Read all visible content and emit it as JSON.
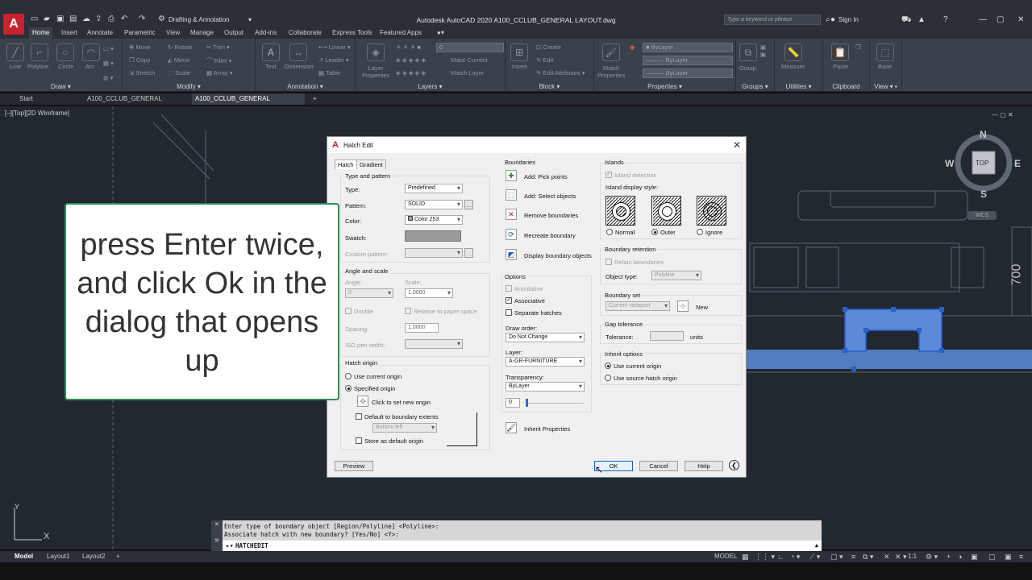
{
  "app": {
    "logo": "A",
    "workspace": "Drafting & Annotation",
    "window_title": "Autodesk AutoCAD 2020   A100_CCLUB_GENERAL LAYOUT.dwg",
    "search_placeholder": "Type a keyword or phrase",
    "sign_in": "Sign In"
  },
  "ribbon_tabs": [
    "Home",
    "Insert",
    "Annotate",
    "Parametric",
    "View",
    "Manage",
    "Output",
    "Add-ins",
    "Collaborate",
    "Express Tools",
    "Featured Apps"
  ],
  "ribbon": {
    "draw": {
      "title": "Draw",
      "tools": [
        "Line",
        "Polyline",
        "Circle",
        "Arc"
      ]
    },
    "modify": {
      "title": "Modify",
      "tools": [
        "Move",
        "Rotate",
        "Trim",
        "Copy",
        "Mirror",
        "Fillet",
        "Stretch",
        "Scale",
        "Array"
      ]
    },
    "annotation": {
      "title": "Annotation",
      "tools": [
        "Text",
        "Dimension",
        "Linear",
        "Leader",
        "Table"
      ]
    },
    "layers": {
      "title": "Layers",
      "tools": [
        "Layer Properties",
        "Make Current",
        "Match Layer"
      ],
      "current": "0"
    },
    "block": {
      "title": "Block",
      "tools": [
        "Insert",
        "Create",
        "Edit",
        "Edit Attributes"
      ]
    },
    "properties": {
      "title": "Properties",
      "tools": [
        "Match Properties"
      ],
      "bylayer": "ByLayer"
    },
    "groups": {
      "title": "Groups",
      "tools": [
        "Group"
      ]
    },
    "utilities": {
      "title": "Utilities",
      "tools": [
        "Measure"
      ]
    },
    "clipboard": {
      "title": "Clipboard",
      "tools": [
        "Paste"
      ]
    },
    "view": {
      "title": "View",
      "tools": [
        "Base"
      ]
    }
  },
  "doc_tabs": [
    "Start",
    "A100_CCLUB_GENERAL Import",
    "A100_CCLUB_GENERAL LAYOUT*"
  ],
  "viewport_label": "[–][Top][2D Wireframe]",
  "viewcube": {
    "top": "TOP",
    "n": "N",
    "s": "S",
    "e": "E",
    "w": "W",
    "wcs": "WCS"
  },
  "dim_text": "700",
  "callout_text": "press Enter twice, and click Ok in the dialog that opens up",
  "dialog": {
    "title": "Hatch Edit",
    "tabs": [
      "Hatch",
      "Gradient"
    ],
    "type_pattern": {
      "title": "Type and pattern",
      "type_label": "Type:",
      "type_value": "Predefined",
      "pattern_label": "Pattern:",
      "pattern_value": "SOLID",
      "color_label": "Color:",
      "color_value": "Color 253",
      "swatch_label": "Swatch:",
      "custom_label": "Custom pattern:"
    },
    "angle_scale": {
      "title": "Angle and scale",
      "angle_label": "Angle:",
      "angle_value": "0",
      "scale_label": "Scale:",
      "scale_value": "1.0000",
      "double_label": "Double",
      "relative_label": "Relative to paper space",
      "spacing_label": "Spacing:",
      "spacing_value": "1.0000",
      "iso_label": "ISO pen width:"
    },
    "hatch_origin": {
      "title": "Hatch origin",
      "use_current": "Use current origin",
      "specified": "Specified origin",
      "click_set": "Click to set new origin",
      "default_extents": "Default to boundary extents",
      "bottom_left": "Bottom left",
      "store_default": "Store as default origin"
    },
    "boundaries": {
      "title": "Boundaries",
      "pick_points": "Add: Pick points",
      "select_objects": "Add: Select objects",
      "remove": "Remove boundaries",
      "recreate": "Recreate boundary",
      "display": "Display boundary objects"
    },
    "options": {
      "title": "Options",
      "annotative": "Annotative",
      "associative": "Associative",
      "separate": "Separate hatches",
      "draw_order_label": "Draw order:",
      "draw_order_value": "Do Not Change",
      "layer_label": "Layer:",
      "layer_value": "A-GR-FURNITURE",
      "transparency_label": "Transparency:",
      "transparency_value": "ByLayer",
      "transparency_number": "0"
    },
    "inherit_properties": "Inherit Properties",
    "islands": {
      "title": "Islands",
      "detection": "Island detection",
      "display_style": "Island display style:",
      "normal": "Normal",
      "outer": "Outer",
      "ignore": "Ignore"
    },
    "boundary_retention": {
      "title": "Boundary retention",
      "retain": "Retain boundaries",
      "object_type_label": "Object type:",
      "object_type_value": "Polyline"
    },
    "boundary_set": {
      "title": "Boundary set",
      "value": "Current viewport",
      "new": "New"
    },
    "gap_tolerance": {
      "title": "Gap tolerance",
      "tolerance_label": "Tolerance:",
      "units": "units"
    },
    "inherit_options": {
      "title": "Inherit options",
      "use_current": "Use current origin",
      "use_source": "Use source hatch origin"
    },
    "buttons": {
      "preview": "Preview",
      "ok": "OK",
      "cancel": "Cancel",
      "help": "Help"
    }
  },
  "command": {
    "line1": "Enter type of boundary object [Region/Polyline] <Polyline>:",
    "line2": "Associate hatch with new boundary? [Yes/No] <Y>:",
    "input": "HATCHEDIT"
  },
  "ucs": {
    "x": "X",
    "y": "Y"
  },
  "status": {
    "layout_tabs": [
      "Model",
      "Layout1",
      "Layout2"
    ],
    "model_label": "MODEL",
    "scale": "1:1"
  },
  "colors": {
    "accent": "#0a64c8",
    "canvas": "#212830",
    "ribbon": "#3b414b",
    "selection": "#5b8bd8",
    "callout_border": "#2e8b57"
  }
}
